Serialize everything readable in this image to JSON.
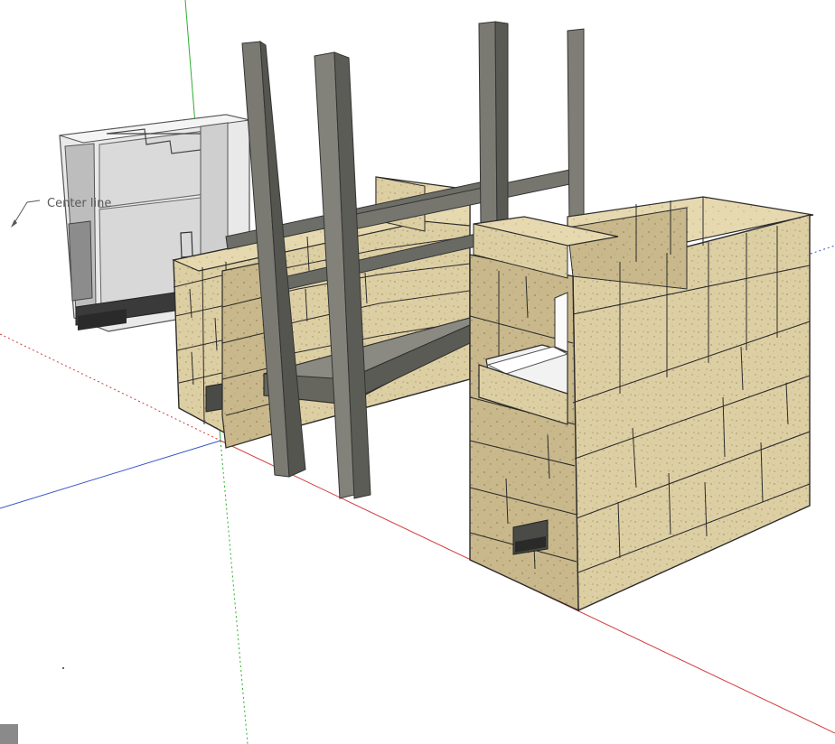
{
  "app": {
    "type": "3D modeling viewport"
  },
  "annotation": {
    "label": "Center line"
  },
  "colors": {
    "background": "#ffffff",
    "axis_red": "#d23c3c",
    "axis_green": "#2fae2f",
    "axis_blue": "#3a55c8",
    "brick_face": "#ddcfa4",
    "brick_side": "#c9b98a",
    "brick_top": "#e9dcb4",
    "steel": "#7a7a72",
    "steel_dark": "#55554f",
    "ghost_gray": "#dcdcdc"
  },
  "icons": {
    "corner_widget": "model-info-tab-icon",
    "leader_arrow": "leader-arrow-icon"
  }
}
